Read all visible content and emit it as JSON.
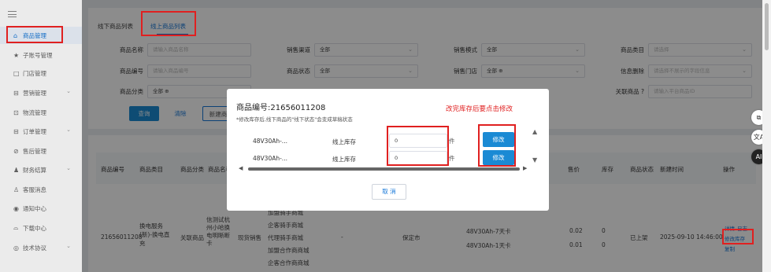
{
  "sidebar": {
    "items": [
      {
        "label": "商品管理",
        "icon": "home-icon",
        "glyph": "⌂",
        "chev": ""
      },
      {
        "label": "子账号管理",
        "icon": "star-icon",
        "glyph": "★",
        "chev": ""
      },
      {
        "label": "门店管理",
        "icon": "store-icon",
        "glyph": "□",
        "chev": ""
      },
      {
        "label": "营销管理",
        "icon": "marketing-icon",
        "glyph": "⊟",
        "chev": "⌄"
      },
      {
        "label": "物流管理",
        "icon": "truck-icon",
        "glyph": "⊡",
        "chev": ""
      },
      {
        "label": "订单管理",
        "icon": "order-icon",
        "glyph": "⊟",
        "chev": "⌄"
      },
      {
        "label": "售后管理",
        "icon": "aftersale-icon",
        "glyph": "⊘",
        "chev": ""
      },
      {
        "label": "财务结算",
        "icon": "finance-icon",
        "glyph": "♟",
        "chev": "⌄"
      },
      {
        "label": "客服消息",
        "icon": "service-icon",
        "glyph": "♙",
        "chev": ""
      },
      {
        "label": "通知中心",
        "icon": "bell-icon",
        "glyph": "◉",
        "chev": ""
      },
      {
        "label": "下载中心",
        "icon": "download-icon",
        "glyph": "⌓",
        "chev": ""
      },
      {
        "label": "技术协议",
        "icon": "protocol-icon",
        "glyph": "◎",
        "chev": "⌄"
      }
    ]
  },
  "tabs": [
    "线下商品列表",
    "线上商品列表"
  ],
  "filters": {
    "row1": [
      {
        "label": "商品名称",
        "value": "请输入商品名称",
        "type": "input"
      },
      {
        "label": "销售渠道",
        "value": "全部",
        "type": "select"
      },
      {
        "label": "销售模式",
        "value": "全部",
        "type": "select"
      },
      {
        "label": "商品类目",
        "value": "请选择",
        "type": "select"
      }
    ],
    "row2": [
      {
        "label": "商品编号",
        "value": "请输入商品编号",
        "type": "input"
      },
      {
        "label": "商品状态",
        "value": "全部",
        "type": "select"
      },
      {
        "label": "销售门店",
        "value": "全部 ⊕",
        "type": "select"
      },
      {
        "label": "信息删除",
        "value": "请选择不展示的字段信息",
        "type": "select"
      }
    ],
    "row3_left": {
      "label": "商品分类",
      "value": "全部 ⊕"
    },
    "row3_right": {
      "label": "关联商品",
      "value": "请输入平台商品ID",
      "help": "?"
    }
  },
  "buttons": {
    "query": "查询",
    "clear": "清除",
    "create": "新建商"
  },
  "table": {
    "headers": [
      "商品编号",
      "商品类目",
      "商品分类",
      "商品名称",
      "售价",
      "库存",
      "商品状态",
      "新建时间",
      "操作"
    ],
    "row": {
      "id": "21656011208",
      "category": "换电服务(新)-换电直充",
      "classification": "关联商品",
      "name": "信测试杭州小哈换电明晰断卡",
      "sale_type": "现货销售",
      "channels": [
        "加盟骑手商城",
        "企客骑手商城",
        "代理骑手商城",
        "加盟合作商商城",
        "企客合作商商城"
      ],
      "dash": "-",
      "city": "保定市",
      "specs": [
        "48V30Ah-7天卡",
        "48V30Ah-1天卡"
      ],
      "prices": [
        "0.02",
        "0.01"
      ],
      "stocks": [
        "0",
        "0"
      ],
      "status": "已上架",
      "created": "2025-09-10 14:46:00",
      "actions": [
        "详情",
        "日志",
        "修改库存",
        "复制"
      ]
    }
  },
  "modal": {
    "title": "商品编号:21656011208",
    "note": "*修改库存后,线下商品的\"线下状态\"会变成草稿状态",
    "annotation": "改完库存后要点击修改",
    "rows": [
      {
        "spec": "48V30Ah-...",
        "stock_label": "线上库存",
        "value": "0",
        "unit": "件",
        "btn": "修改"
      },
      {
        "spec": "48V30Ah-...",
        "stock_label": "线上库存",
        "value": "0",
        "unit": "件",
        "btn": "修改"
      }
    ],
    "cancel": "取 消"
  },
  "right_icons": [
    "external-icon",
    "translate-icon",
    "ai-icon"
  ],
  "right_glyphs": [
    "⧉",
    "文A",
    "AI"
  ],
  "colors": {
    "accent": "#1677d8",
    "button": "#1a8ad4",
    "annotation": "#e02020"
  }
}
